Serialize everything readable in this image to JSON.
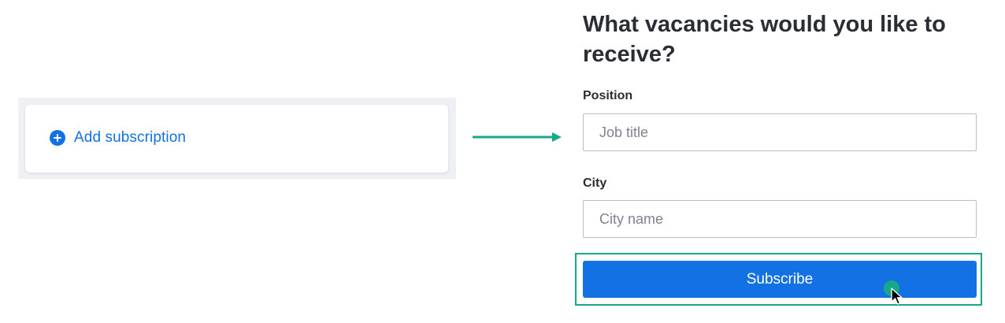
{
  "subscriptions": {
    "add_label": "Add subscription",
    "add_icon": "plus-circle-icon"
  },
  "arrow_icon": "arrow-right-icon",
  "form": {
    "title": "What vacancies would you like to receive?",
    "position": {
      "label": "Position",
      "value": "",
      "placeholder": "Job title"
    },
    "city": {
      "label": "City",
      "value": "",
      "placeholder": "City name"
    },
    "subscribe_label": "Subscribe"
  },
  "colors": {
    "accent": "#1371e3",
    "highlight": "#17a88a",
    "text": "#2a2d33",
    "panel_bg": "#eef0f4"
  }
}
